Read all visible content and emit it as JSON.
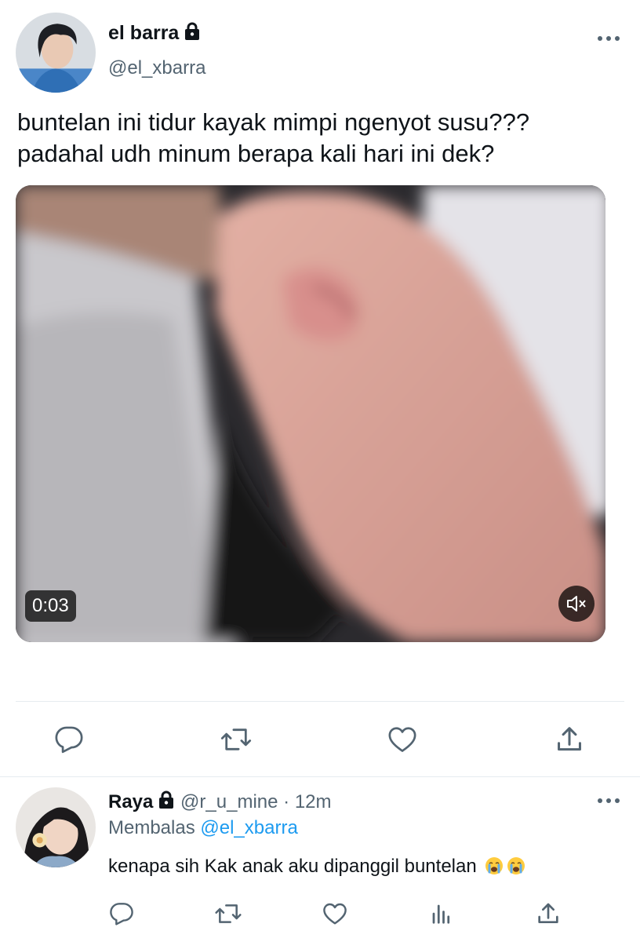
{
  "tweet": {
    "author_name": "el barra",
    "author_handle": "@el_xbarra",
    "text_line1": "buntelan ini tidur kayak mimpi ngenyot susu???",
    "text_line2": "padahal udh minum berapa kali hari ini dek?",
    "video_duration": "0:03",
    "protected_icon": "lock-icon",
    "more_icon": "more-horizontal-icon",
    "mute_icon": "volume-muted-icon"
  },
  "tweet_actions": [
    "reply-icon",
    "retweet-icon",
    "like-icon",
    "share-icon"
  ],
  "reply": {
    "author_name": "Raya",
    "author_handle": "@r_u_mine",
    "separator": "·",
    "time": "12m",
    "replying_label": "Membalas",
    "replying_to": "@el_xbarra",
    "text": "kenapa sih Kak anak aku dipanggil buntelan",
    "emoji": [
      "loudly-crying-face",
      "loudly-crying-face"
    ]
  },
  "reply_actions": [
    "reply-icon",
    "retweet-icon",
    "like-icon",
    "analytics-icon",
    "share-icon"
  ],
  "colors": {
    "text": "#0f1419",
    "secondary": "#536471",
    "link": "#1d9bf0",
    "divider": "#e6ecf0"
  }
}
